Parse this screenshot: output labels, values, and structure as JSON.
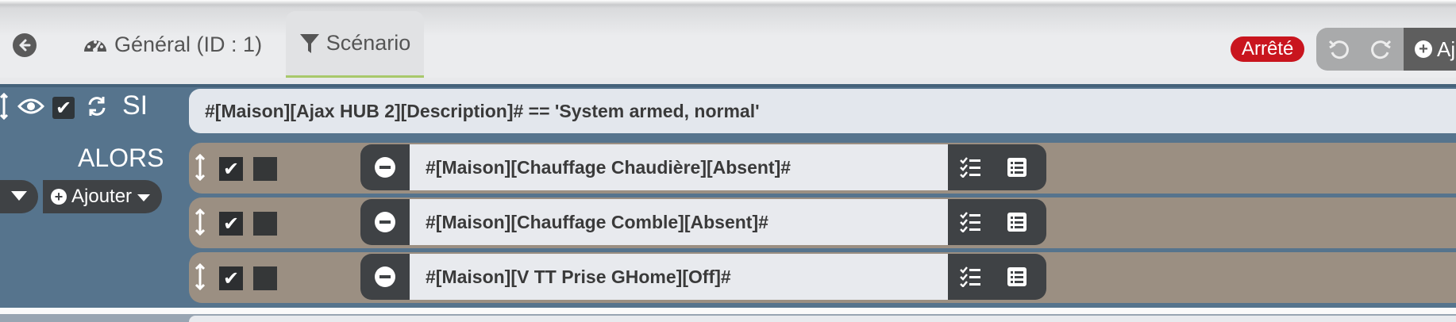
{
  "tabs": {
    "general": "Général (ID : 1)",
    "scenario": "Scénario"
  },
  "status_badge": "Arrêté",
  "toolbar": {
    "add_label": "Aj"
  },
  "block": {
    "si_label": "SI",
    "condition": "#[Maison][Ajax HUB 2][Description]# == 'System armed, normal'",
    "alors_label": "ALORS",
    "add_label": "Ajouter",
    "actions": [
      {
        "command": "#[Maison][Chauffage Chaudière][Absent]#",
        "enabled": true
      },
      {
        "command": "#[Maison][Chauffage Comble][Absent]#",
        "enabled": true
      },
      {
        "command": "#[Maison][V TT Prise GHome][Off]#",
        "enabled": true
      }
    ]
  },
  "colors": {
    "block_bg": "#56748d",
    "action_bg": "#9b8f82",
    "badge_red": "#c9151e",
    "active_tab_underline": "#a8c86b"
  },
  "icons": [
    "arrow-left-icon",
    "dashboard-icon",
    "filter-icon",
    "undo-icon",
    "redo-icon",
    "plus-circle-icon",
    "move-vertical-icon",
    "eye-icon",
    "refresh-icon",
    "minus-circle-icon",
    "checklist-icon",
    "list-icon",
    "caret-down-icon"
  ]
}
